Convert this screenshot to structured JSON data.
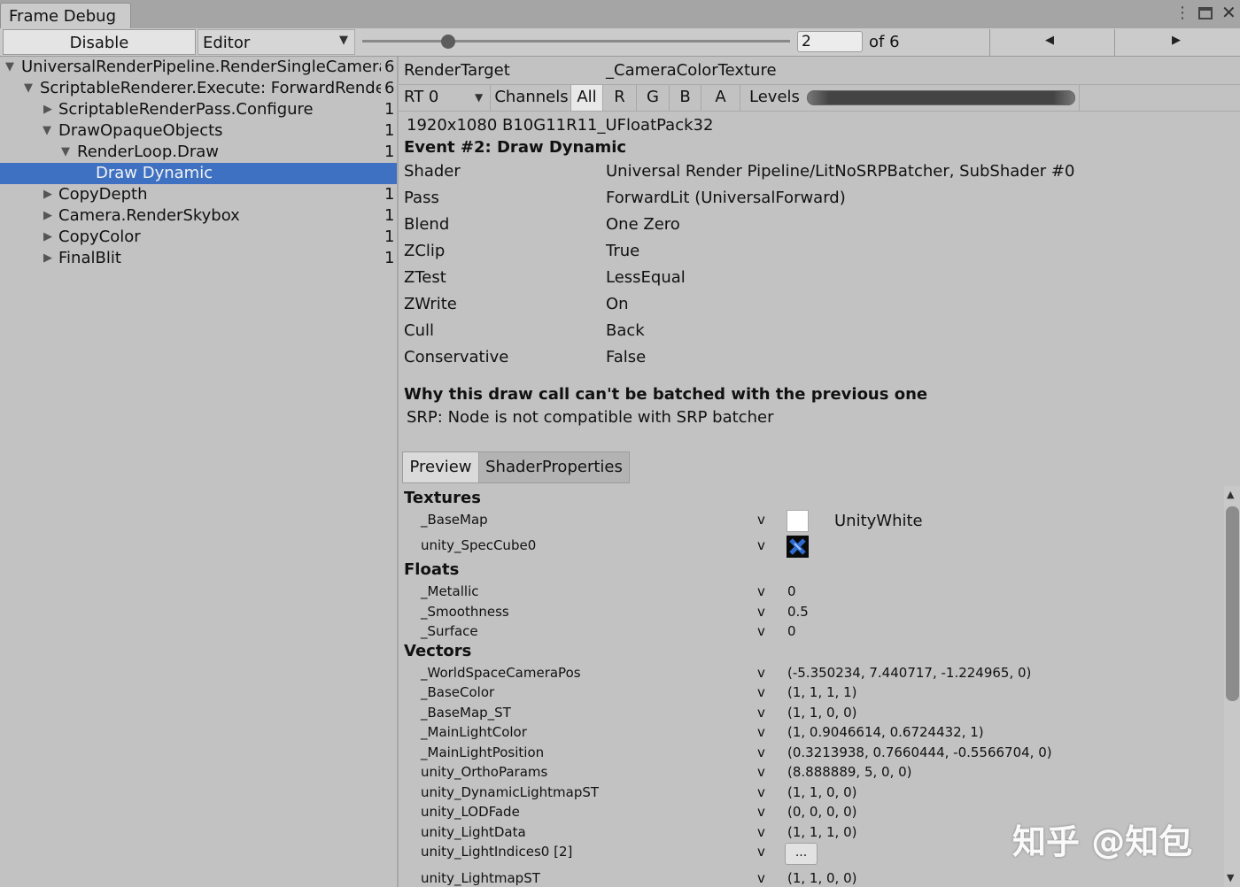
{
  "window": {
    "tab_title": "Frame Debug",
    "menu_icon": "kebab-menu-icon",
    "max_icon": "maximize-icon",
    "close_icon": "close-icon",
    "close_glyph": "✕"
  },
  "toolbar": {
    "disable_label": "Disable",
    "source_value": "Editor",
    "frame_value": "2",
    "of_label": "of 6",
    "slider_fraction": 0.2
  },
  "tree": {
    "items": [
      {
        "label": "UniversalRenderPipeline.RenderSingleCamera",
        "count": "6"
      },
      {
        "label": "ScriptableRenderer.Execute: ForwardRenderer",
        "count": "6"
      },
      {
        "label": "ScriptableRenderPass.Configure",
        "count": "1"
      },
      {
        "label": "DrawOpaqueObjects",
        "count": "1"
      },
      {
        "label": "RenderLoop.Draw",
        "count": "1"
      },
      {
        "label": "Draw Dynamic",
        "count": ""
      },
      {
        "label": "CopyDepth",
        "count": "1"
      },
      {
        "label": "Camera.RenderSkybox",
        "count": "1"
      },
      {
        "label": "CopyColor",
        "count": "1"
      },
      {
        "label": "FinalBlit",
        "count": "1"
      }
    ]
  },
  "render_target": {
    "label": "RenderTarget",
    "value": "_CameraColorTexture",
    "rt_select": "RT 0",
    "channels_label": "Channels",
    "channels": [
      "All",
      "R",
      "G",
      "B",
      "A"
    ],
    "levels_label": "Levels",
    "format": "1920x1080 B10G11R11_UFloatPack32"
  },
  "event": {
    "title": "Event #2: Draw Dynamic",
    "rows": [
      {
        "key": "Shader",
        "value": "Universal Render Pipeline/LitNoSRPBatcher, SubShader #0"
      },
      {
        "key": "Pass",
        "value": "ForwardLit (UniversalForward)"
      },
      {
        "key": "Blend",
        "value": "One Zero"
      },
      {
        "key": "ZClip",
        "value": "True"
      },
      {
        "key": "ZTest",
        "value": "LessEqual"
      },
      {
        "key": "ZWrite",
        "value": "On"
      },
      {
        "key": "Cull",
        "value": "Back"
      },
      {
        "key": "Conservative",
        "value": "False"
      }
    ],
    "batch_heading": "Why this draw call can't be batched with the previous one",
    "batch_reason": "SRP: Node is not compatible with SRP batcher"
  },
  "tabs": {
    "preview": "Preview",
    "shader_properties": "ShaderProperties"
  },
  "properties": {
    "textures_heading": "Textures",
    "textures": [
      {
        "name": "_BaseMap",
        "stage": "v",
        "value": "UnityWhite"
      },
      {
        "name": "unity_SpecCube0",
        "stage": "v",
        "value": ""
      }
    ],
    "floats_heading": "Floats",
    "floats": [
      {
        "name": "_Metallic",
        "stage": "v",
        "value": "0"
      },
      {
        "name": "_Smoothness",
        "stage": "v",
        "value": "0.5"
      },
      {
        "name": "_Surface",
        "stage": "v",
        "value": "0"
      }
    ],
    "vectors_heading": "Vectors",
    "vectors": [
      {
        "name": "_WorldSpaceCameraPos",
        "stage": "v",
        "value": "(-5.350234, 7.440717, -1.224965, 0)"
      },
      {
        "name": "_BaseColor",
        "stage": "v",
        "value": "(1, 1, 1, 1)"
      },
      {
        "name": "_BaseMap_ST",
        "stage": "v",
        "value": "(1, 1, 0, 0)"
      },
      {
        "name": "_MainLightColor",
        "stage": "v",
        "value": "(1, 0.9046614, 0.6724432, 1)"
      },
      {
        "name": "_MainLightPosition",
        "stage": "v",
        "value": "(0.3213938, 0.7660444, -0.5566704, 0)"
      },
      {
        "name": "unity_OrthoParams",
        "stage": "v",
        "value": "(8.888889, 5, 0, 0)"
      },
      {
        "name": "unity_DynamicLightmapST",
        "stage": "v",
        "value": "(1, 1, 0, 0)"
      },
      {
        "name": "unity_LODFade",
        "stage": "v",
        "value": "(0, 0, 0, 0)"
      },
      {
        "name": "unity_LightData",
        "stage": "v",
        "value": "(1, 1, 1, 0)"
      },
      {
        "name": "unity_LightIndices0 [2]",
        "stage": "v",
        "value": "..."
      },
      {
        "name": "unity_LightmapST",
        "stage": "v",
        "value": "(1, 1, 0, 0)"
      }
    ]
  },
  "watermark": "知乎 @知包",
  "colors": {
    "selection": "#3f71c2",
    "panel": "#c2c2c2",
    "toolbar": "#cbcbcb"
  }
}
